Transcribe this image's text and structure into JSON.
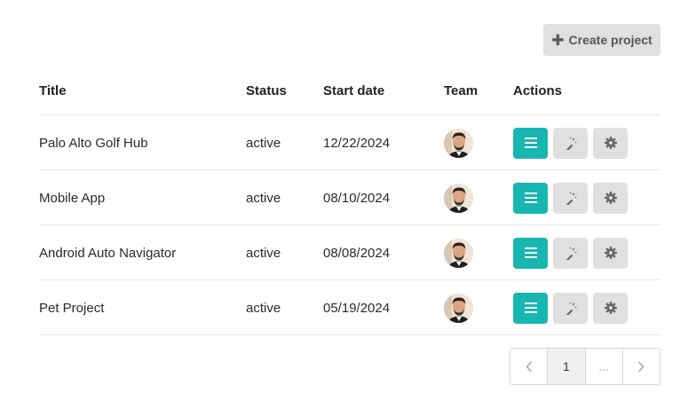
{
  "toolbar": {
    "create_label": "Create project",
    "create_icon": "plus-icon"
  },
  "table": {
    "headers": {
      "title": "Title",
      "status": "Status",
      "start_date": "Start date",
      "team": "Team",
      "actions": "Actions"
    },
    "rows": [
      {
        "title": "Palo Alto Golf Hub",
        "status": "active",
        "start_date": "12/22/2024"
      },
      {
        "title": "Mobile App",
        "status": "active",
        "start_date": "08/10/2024"
      },
      {
        "title": "Android Auto Navigator",
        "status": "active",
        "start_date": "08/08/2024"
      },
      {
        "title": "Pet Project",
        "status": "active",
        "start_date": "05/19/2024"
      }
    ],
    "action_icons": [
      "list-icon",
      "magic-wand-icon",
      "gear-icon"
    ]
  },
  "pagination": {
    "current_page": "1",
    "ellipsis": "..."
  },
  "colors": {
    "primary": "#18b6b0",
    "secondary": "#e0e0e0"
  }
}
